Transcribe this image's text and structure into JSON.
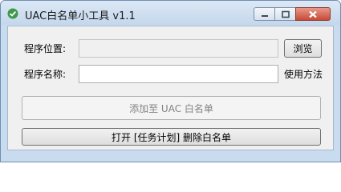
{
  "window": {
    "title": "UAC白名单小工具 v1.1"
  },
  "form": {
    "path_label": "程序位置:",
    "path_value": "",
    "browse_label": "浏览",
    "name_label": "程序名称:",
    "name_value": "",
    "usage_label": "使用方法"
  },
  "actions": {
    "add_label": "添加至 UAC 白名单",
    "open_task_label": "打开 [任务计划] 删除白名单"
  },
  "colors": {
    "accent": "#3c9a4a",
    "titlebar": "#c9dbee",
    "close_button": "#c94a35"
  }
}
